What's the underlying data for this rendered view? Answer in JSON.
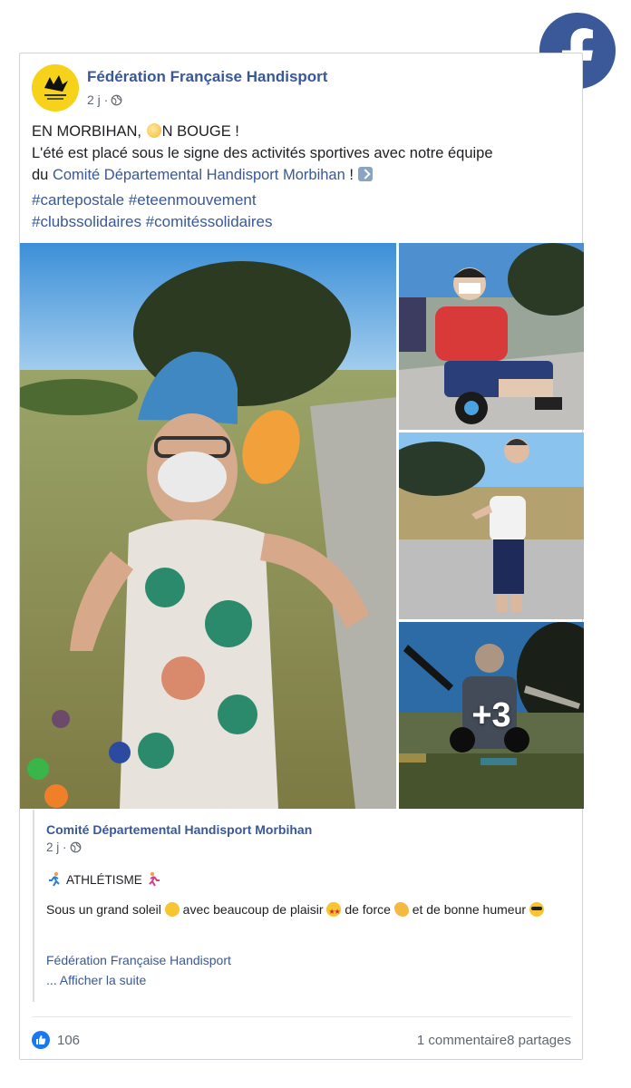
{
  "post": {
    "author": "Fédération Française Handisport",
    "time": "2 j ·",
    "line1_prefix": "EN MORBIHAN, ",
    "line1_suffix": "N BOUGE !",
    "line2": "L'été est placé sous le signe des activités sportives avec notre équipe",
    "line3_prefix": "du ",
    "line3_link": "Comité Départemental Handisport Morbihan",
    "line3_suffix": " ! ",
    "hashtags_line1": "#cartepostale #eteenmouvement",
    "hashtags_line2": "#clubssolidaires #comitéssolidaires",
    "more_photos": "+3"
  },
  "shared": {
    "author": "Comité Départemental Handisport Morbihan",
    "time": "2 j ·",
    "title": "ATHLÉTISME",
    "body_1": "Sous un grand soleil ",
    "body_2": " avec beaucoup de plaisir ",
    "body_3": " de force ",
    "body_4": " et de bonne humeur ",
    "link1": "Fédération Française Handisport",
    "link2": "... Afficher la suite"
  },
  "footer": {
    "likes": "106",
    "comments": "1 commentaire",
    "shares": "8 partages"
  },
  "colors": {
    "link": "#385898",
    "facebook": "#3b5998",
    "like": "#1877f2"
  }
}
